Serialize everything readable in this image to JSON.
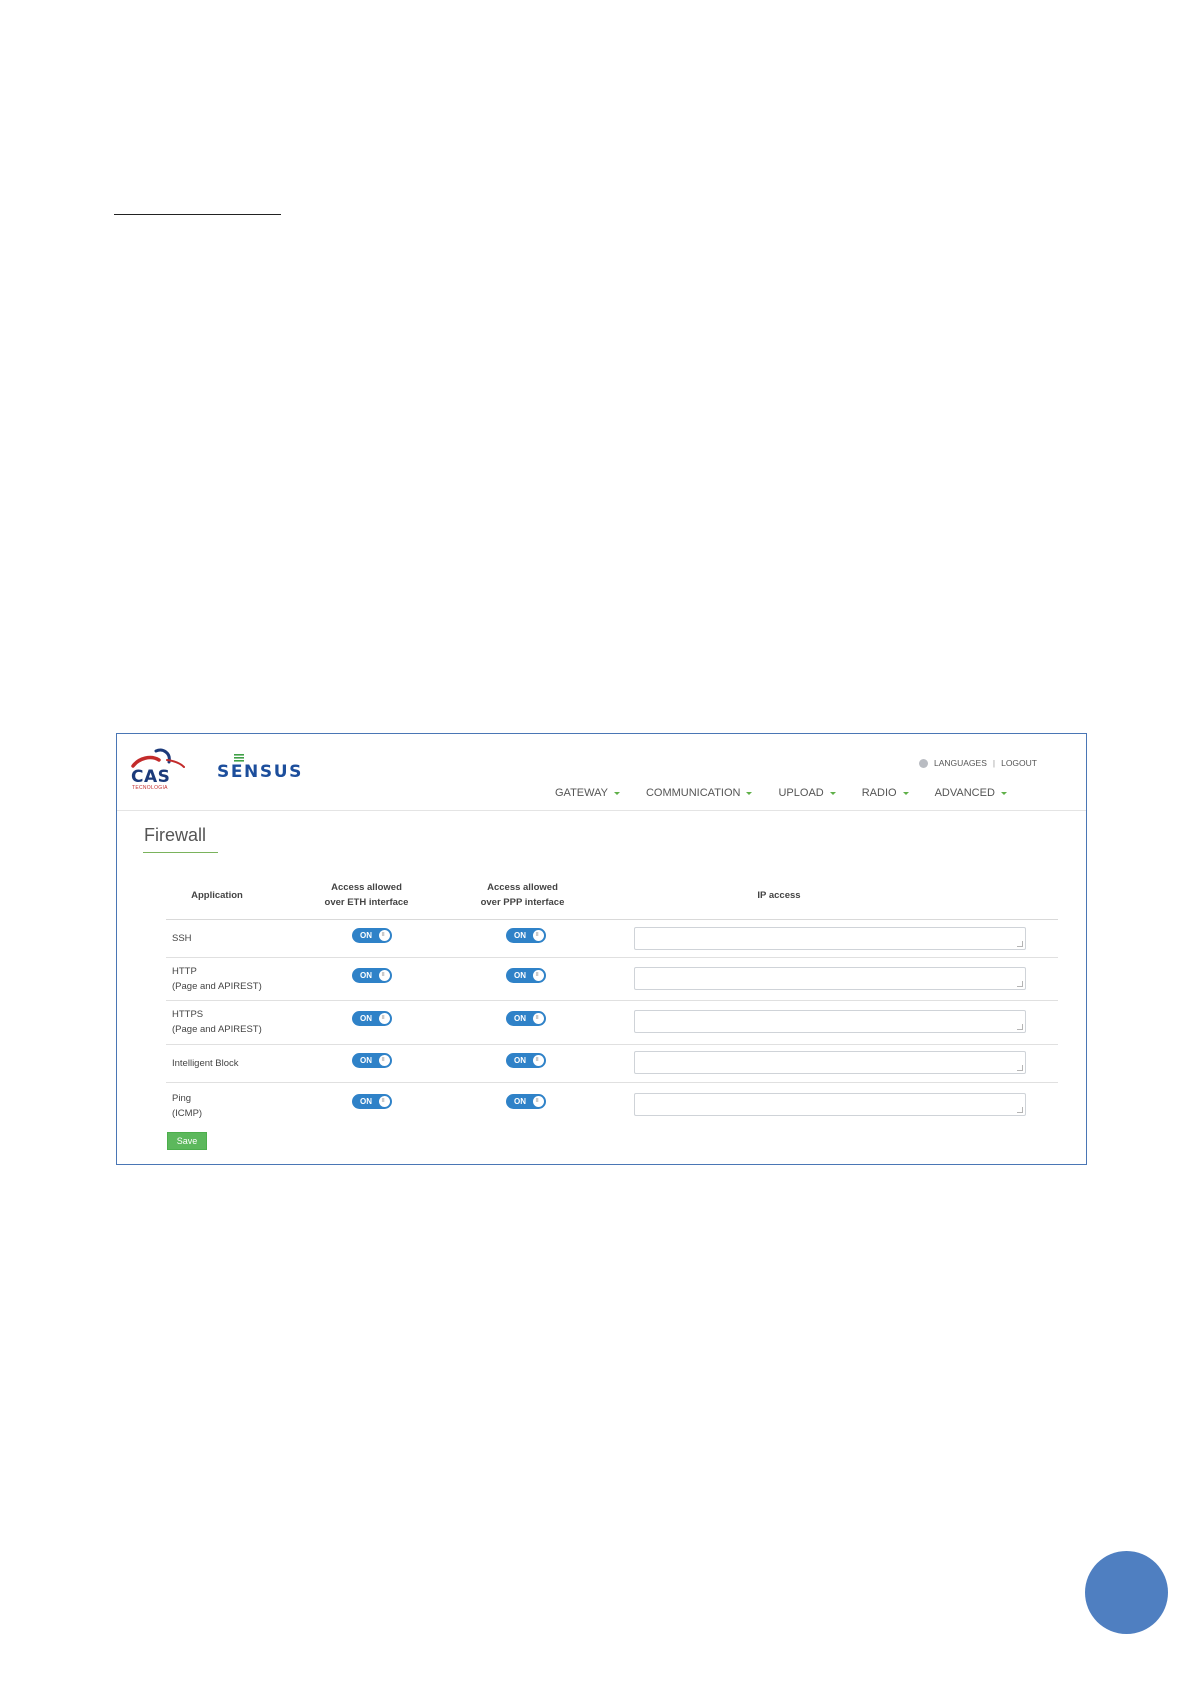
{
  "screenshot": {
    "logos": {
      "cas": {
        "text": "CAS",
        "subtitle": "TECNOLOGIA"
      },
      "sensus": {
        "text": "SENSUS"
      }
    },
    "top_links": {
      "languages": "LANGUAGES",
      "separator": "|",
      "logout": "LOGOUT"
    },
    "nav": {
      "items": [
        {
          "label": "GATEWAY"
        },
        {
          "label": "COMMUNICATION"
        },
        {
          "label": "UPLOAD"
        },
        {
          "label": "RADIO"
        },
        {
          "label": "ADVANCED"
        }
      ]
    },
    "page_title": "Firewall",
    "table": {
      "headers": {
        "application": "Application",
        "eth_line1": "Access allowed",
        "eth_line2": "over ETH interface",
        "ppp_line1": "Access allowed",
        "ppp_line2": "over PPP interface",
        "ip_access": "IP access"
      },
      "rows": [
        {
          "line1": "SSH",
          "line2": "",
          "eth": "ON",
          "ppp": "ON",
          "ip": ""
        },
        {
          "line1": "HTTP",
          "line2": "(Page and APIREST)",
          "eth": "ON",
          "ppp": "ON",
          "ip": ""
        },
        {
          "line1": "HTTPS",
          "line2": "(Page and APIREST)",
          "eth": "ON",
          "ppp": "ON",
          "ip": ""
        },
        {
          "line1": "Intelligent Block",
          "line2": "",
          "eth": "ON",
          "ppp": "ON",
          "ip": ""
        },
        {
          "line1": "Ping",
          "line2": "(ICMP)",
          "eth": "ON",
          "ppp": "ON",
          "ip": ""
        }
      ]
    },
    "save_label": "Save",
    "colors": {
      "frame": "#4a76b5",
      "toggle_on": "#2f82c8",
      "save_button": "#5cb85c",
      "accent_green": "#7ab35c",
      "page_badge": "#4f7fc1"
    }
  }
}
